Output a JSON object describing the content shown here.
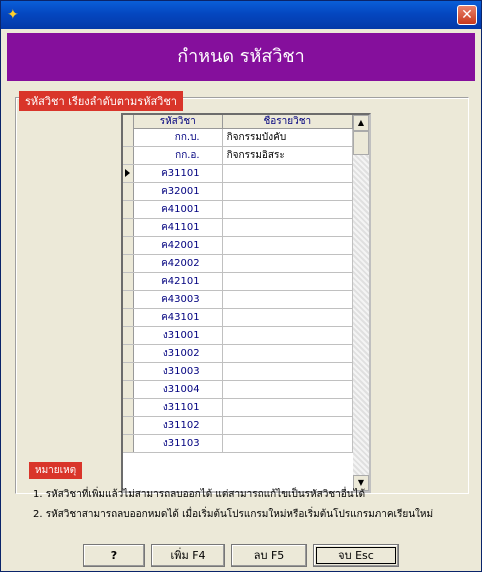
{
  "window": {
    "icon": "app-icon",
    "close": "close-icon"
  },
  "header": {
    "title": "กำหนด รหัสวิชา"
  },
  "group": {
    "label": "รหัสวิชา เรียงลำดับตามรหัสวิชา"
  },
  "grid": {
    "columns": [
      "รหัสวิชา",
      "ชื่อรายวิชา"
    ],
    "rows": [
      {
        "code": "กก.บ.",
        "name": "กิจกรรมบังคับ"
      },
      {
        "code": "กก.อ.",
        "name": "กิจกรรมอิสระ"
      },
      {
        "code": "ค31101",
        "name": "",
        "active": true
      },
      {
        "code": "ค32001",
        "name": ""
      },
      {
        "code": "ค41001",
        "name": ""
      },
      {
        "code": "ค41101",
        "name": ""
      },
      {
        "code": "ค42001",
        "name": ""
      },
      {
        "code": "ค42002",
        "name": ""
      },
      {
        "code": "ค42101",
        "name": ""
      },
      {
        "code": "ค43003",
        "name": ""
      },
      {
        "code": "ค43101",
        "name": ""
      },
      {
        "code": "ง31001",
        "name": ""
      },
      {
        "code": "ง31002",
        "name": ""
      },
      {
        "code": "ง31003",
        "name": ""
      },
      {
        "code": "ง31004",
        "name": ""
      },
      {
        "code": "ง31101",
        "name": ""
      },
      {
        "code": "ง31102",
        "name": ""
      },
      {
        "code": "ง31103",
        "name": ""
      }
    ]
  },
  "notes": {
    "label": "หมายเหตุ",
    "line1": "1. รหัสวิชาที่เพิ่มแล้วไม่สามารถลบออกได้ แต่สามารถแก้ไขเป็นรหัสวิชาอื่นได้",
    "line2": "2. รหัสวิชาสามารถลบออกหมดได้ เมื่อเริ่มต้นโปรแกรมใหม่หรือเริ่มต้นโปรแกรมภาคเรียนใหม่"
  },
  "buttons": {
    "help": "?",
    "add": "เพิ่ม F4",
    "delete": "ลบ F5",
    "exit": "จบ Esc"
  },
  "colors": {
    "header_bg": "#850f9c",
    "label_bg": "#d9352a",
    "titlebar": "#0447c0"
  }
}
